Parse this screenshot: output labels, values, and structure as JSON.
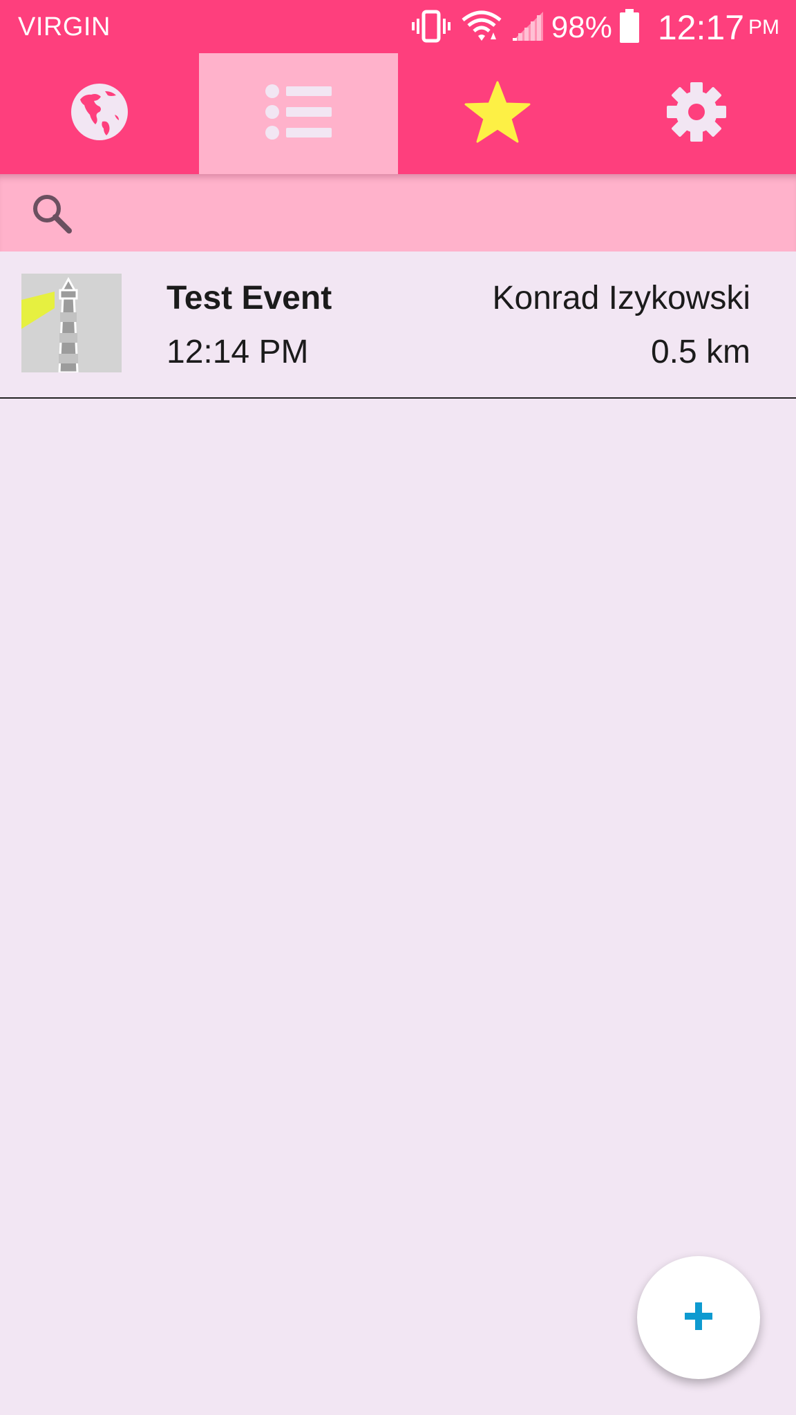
{
  "status_bar": {
    "carrier": "VIRGIN",
    "battery_percent": "98%",
    "time": "12:17",
    "ampm": "PM",
    "icons": [
      "vibrate-icon",
      "wifi-icon",
      "signal-icon",
      "battery-icon"
    ]
  },
  "tabs": [
    {
      "icon": "globe-icon",
      "active": false
    },
    {
      "icon": "list-icon",
      "active": true
    },
    {
      "icon": "star-icon",
      "active": false
    },
    {
      "icon": "gear-icon",
      "active": false
    }
  ],
  "search": {
    "placeholder": "",
    "value": ""
  },
  "events": [
    {
      "title": "Test Event",
      "time": "12:14 PM",
      "author": "Konrad Izykowski",
      "distance": "0.5 km",
      "thumbnail_icon": "lighthouse-icon"
    }
  ],
  "fab": {
    "icon": "plus-icon"
  },
  "colors": {
    "primary": "#fe3f7d",
    "primary_light": "#ffb2cb",
    "background": "#f2e6f3",
    "tab_icon": "#f2e6f3",
    "star": "#fdf045",
    "fab_plus": "#0e9ad0"
  }
}
